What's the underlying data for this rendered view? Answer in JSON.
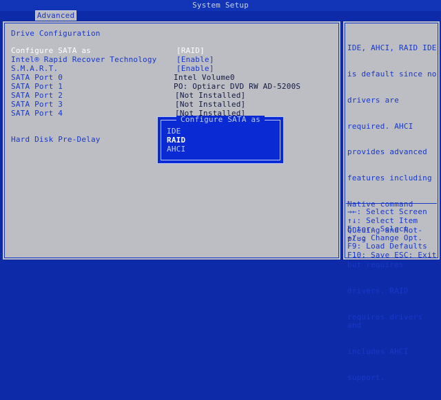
{
  "header": {
    "title": "System Setup",
    "active_tab": "Advanced"
  },
  "main": {
    "section_title": "Drive Configuration",
    "settings": [
      {
        "label": "Configure SATA as",
        "value": "[RAID]"
      },
      {
        "label": "Intel® Rapid Recover Technology",
        "value": "[Enable]"
      },
      {
        "label": "S.M.A.R.T.",
        "value": "[Enable]"
      },
      {
        "label": "SATA Port 0",
        "value": "Intel Volume0"
      },
      {
        "label": "SATA Port 1",
        "value": "PO: Optiarc DVD RW AD-5200S"
      },
      {
        "label": "SATA Port 2",
        "value": "[Not Installed]"
      },
      {
        "label": "SATA Port 3",
        "value": "[Not Installed]"
      },
      {
        "label": "SATA Port 4",
        "value": "[Not Installed]"
      },
      {
        "label": "Hard Disk Pre-Delay",
        "value": ""
      }
    ]
  },
  "popup": {
    "title": "Configure SATA as",
    "options": [
      "IDE",
      "RAID",
      "AHCI"
    ],
    "selected": "RAID"
  },
  "help": {
    "description": "IDE, AHCI, RAID IDE is default since no drivers are required. AHCI provides advanced features including Native command Queuing and Hot-plug but requires drivers. RAID requires drivers and includes AHCI support.",
    "description_lines": [
      "IDE, AHCI, RAID IDE",
      "is default since no",
      "drivers are",
      "required. AHCI",
      "provides advanced",
      "features including",
      "Native command",
      "Queuing and Hot-plug",
      "but requires",
      "drivers. RAID",
      "requires drivers and",
      "includes AHCI",
      "support."
    ],
    "keys": [
      "→←: Select Screen",
      "↑↓: Select Item",
      "Enter: Select",
      "+/-: Change Opt.",
      "F9: Load Defaults",
      "F10: Save  ESC: Exit"
    ]
  }
}
